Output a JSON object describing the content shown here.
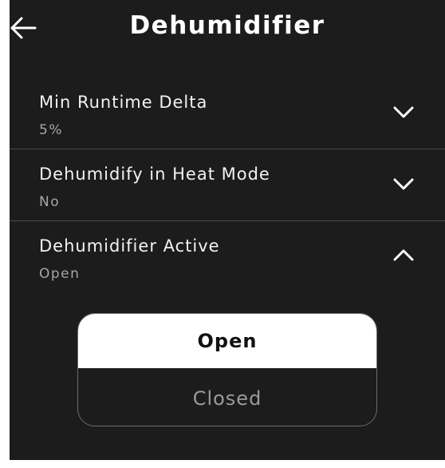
{
  "header": {
    "title": "Dehumidifier",
    "back_icon": "arrow-left-icon"
  },
  "settings": [
    {
      "label": "Min Runtime Delta",
      "value": "5%",
      "icon": "chevron-down-icon",
      "expanded": false
    },
    {
      "label": "Dehumidify in Heat Mode",
      "value": "No",
      "icon": "chevron-down-icon",
      "expanded": false
    },
    {
      "label": "Dehumidifier Active",
      "value": "Open",
      "icon": "chevron-up-icon",
      "expanded": true
    }
  ],
  "picker": {
    "options": [
      "Open",
      "Closed"
    ],
    "selected": "Open"
  },
  "colors": {
    "background": "#1c1c1c",
    "text": "#f2f2f2",
    "subtext": "#a6a6a6",
    "selected_bg": "#ffffff"
  }
}
